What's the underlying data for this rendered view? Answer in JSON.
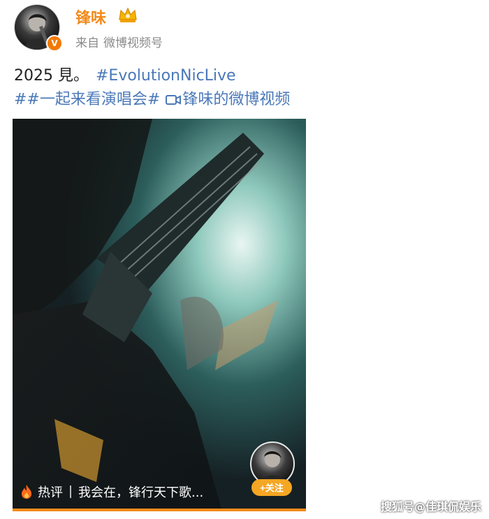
{
  "header": {
    "user_name": "锋味",
    "source_prefix": "来自",
    "source_name": "微博视频号",
    "verified_mark": "V"
  },
  "post": {
    "text_main": "2025 見。",
    "hashtag1": "#EvolutionNicLive",
    "hashtag2": "##一起来看演唱会#",
    "video_link": "锋味的微博视频"
  },
  "video": {
    "hot_label": "热评",
    "hot_comment": "我会在，锋行天下歌...",
    "follow_label": "+关注",
    "progress": 1.0
  },
  "watermark": "搜狐号@佳琪侃娱乐",
  "colors": {
    "brand_orange": "#f28a1a",
    "link_blue": "#4a78b8",
    "follow_orange": "#f5a623"
  }
}
